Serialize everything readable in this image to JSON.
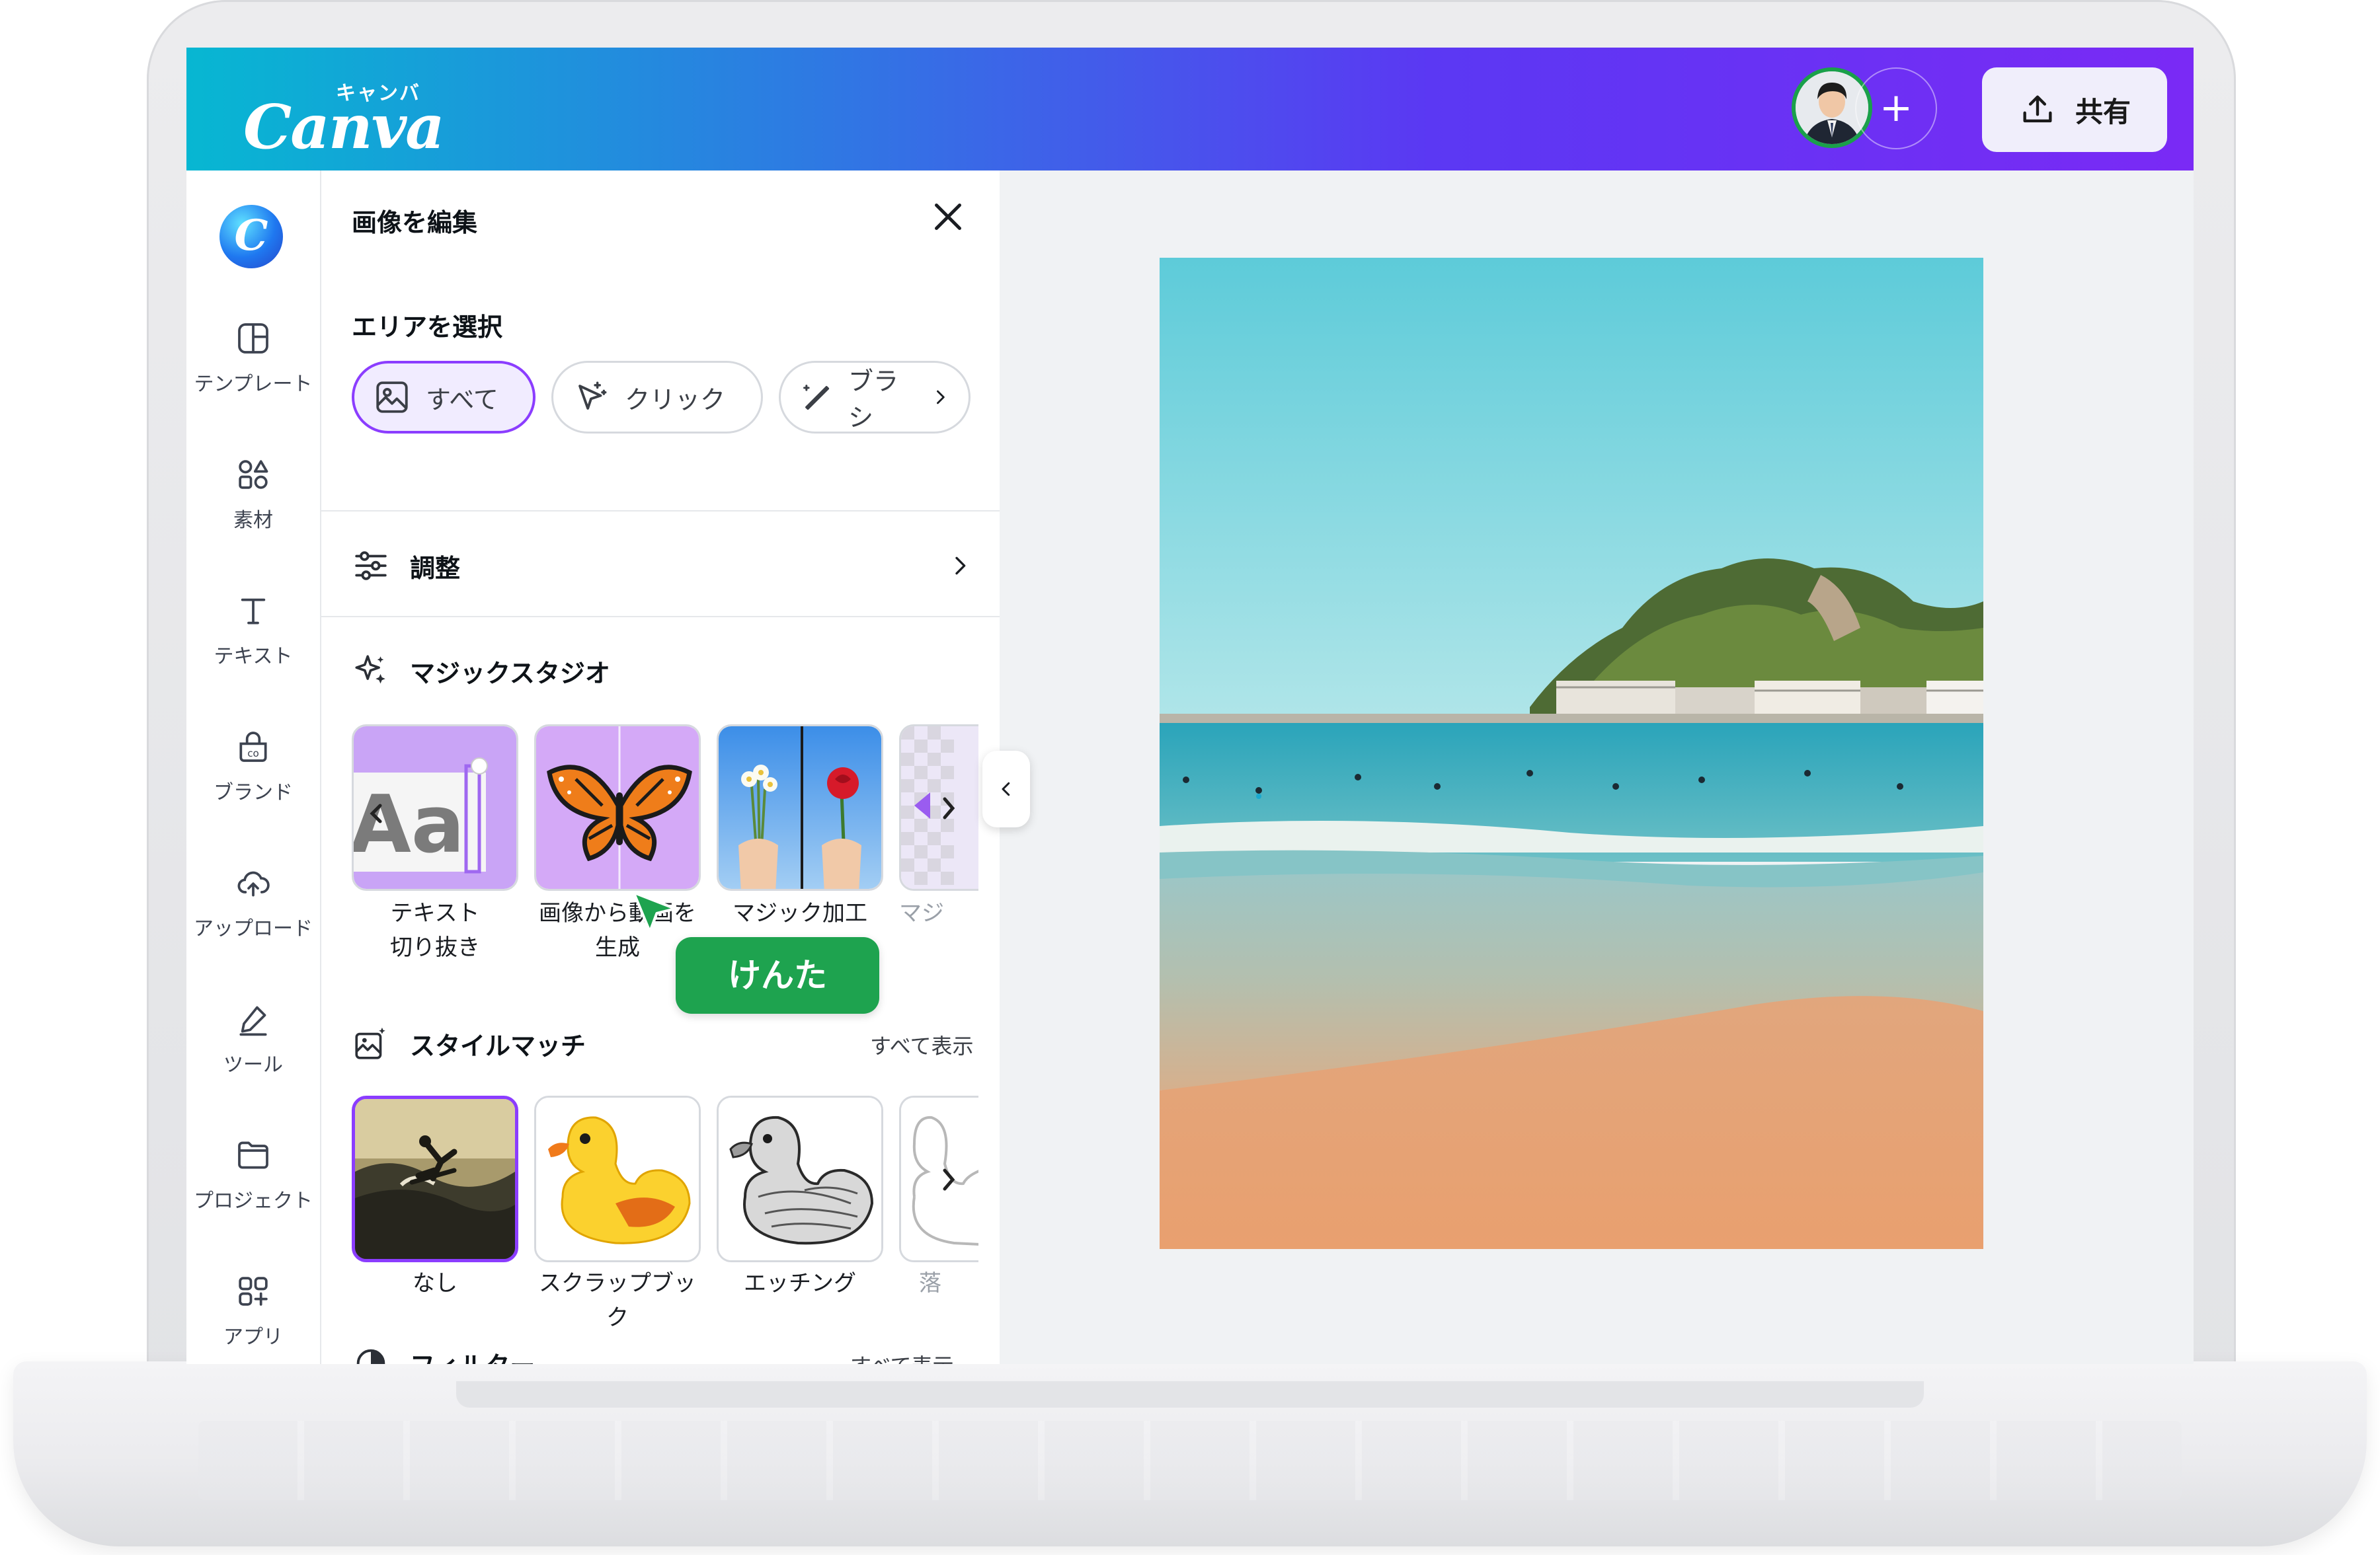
{
  "topbar": {
    "logo_kana": "キャンバ",
    "logo_text": "Canva",
    "add_member": "+",
    "share_label": "共有"
  },
  "rail": {
    "logo_letter": "C",
    "items": [
      {
        "label": "テンプレート",
        "icon": "template-icon"
      },
      {
        "label": "素材",
        "icon": "elements-icon"
      },
      {
        "label": "テキスト",
        "icon": "text-icon"
      },
      {
        "label": "ブランド",
        "icon": "brand-icon"
      },
      {
        "label": "アップロード",
        "icon": "upload-icon"
      },
      {
        "label": "ツール",
        "icon": "tools-icon"
      },
      {
        "label": "プロジェクト",
        "icon": "folder-icon"
      },
      {
        "label": "アプリ",
        "icon": "apps-icon"
      }
    ]
  },
  "panel": {
    "title": "画像を編集",
    "area_label": "エリアを選択",
    "chips": [
      {
        "label": "すべて",
        "active": true
      },
      {
        "label": "クリック",
        "active": false
      },
      {
        "label": "ブラシ",
        "active": false
      }
    ],
    "adjust_label": "調整",
    "magic_studio": {
      "label": "マジックスタジオ",
      "items": [
        {
          "line1": "テキスト",
          "line2": "切り抜き"
        },
        {
          "line1": "画像から動画を",
          "line2": "生成"
        },
        {
          "line1": "マジック加工",
          "line2": ""
        },
        {
          "line1": "マジ",
          "line2": ""
        }
      ]
    },
    "style_match": {
      "label": "スタイルマッチ",
      "show_all": "すべて表示",
      "items": [
        {
          "line1": "なし",
          "line2": ""
        },
        {
          "line1": "スクラップブッ",
          "line2": "ク"
        },
        {
          "line1": "エッチング",
          "line2": ""
        },
        {
          "line1": "落",
          "line2": ""
        }
      ]
    },
    "filter": {
      "label": "フィルター",
      "show_all": "すべて表示"
    }
  },
  "cursor_tag": "けんた",
  "colors": {
    "accent": "#8b3dff",
    "tag_green": "#1ea34f",
    "gradient_start": "#07b7d2",
    "gradient_end": "#7a2af5"
  }
}
